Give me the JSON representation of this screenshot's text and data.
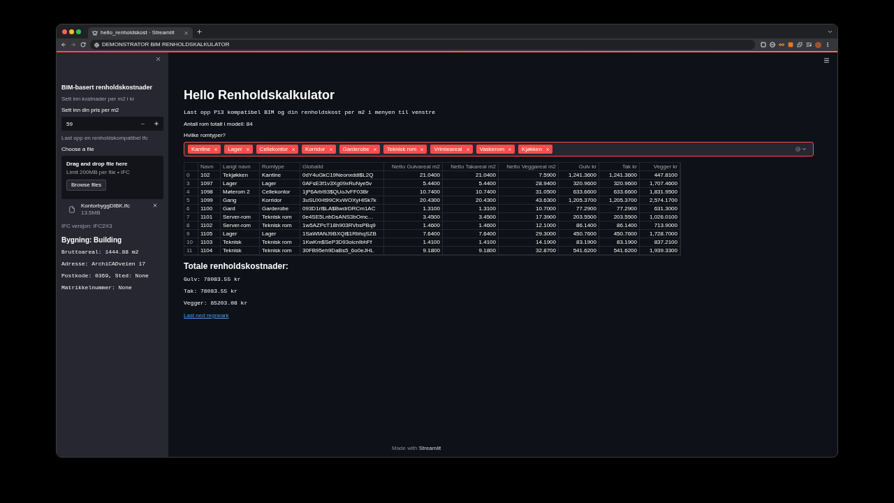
{
  "browser": {
    "tab_title": "hello_renholdskost · Streamlit",
    "address": "DEMONSTRATOR BIM RENHOLDSKALKULATOR"
  },
  "sidebar": {
    "title": "BIM-basert renholdskostnader",
    "caption": "Sett inn kostnader per m2 i kr",
    "price_input": {
      "label": "Sett inn din pris per m2",
      "value": "59"
    },
    "upload_caption": "Last opp en renholdskompatibel ifc",
    "uploader": {
      "label": "Choose a file",
      "dropzone_title": "Drag and drop file here",
      "dropzone_hint": "Limit 200MB per file • IFC",
      "browse_button": "Browse files",
      "files": [
        {
          "name": "KontorbyggDIBK.ifc",
          "size": "13.5MB"
        }
      ]
    },
    "ifc_version": "IFC versjon: IFC2X3",
    "building_heading": "Bygning: Building",
    "building_details": [
      "Bruttoareal: 1444.88 m2",
      "Adresse: ArchiCADveien 17",
      "Postkode: 0369, Sted: None",
      "Matrikkelnummer: None"
    ]
  },
  "main": {
    "title": "Hello Renholdskalkulator",
    "intro": "Last opp P13 kompatibel BIM og din renholdskost per m2 i menyen til venstre",
    "room_count": "Antall rom totalt i modell: 84",
    "multiselect": {
      "label": "Hvilke romtyper?",
      "options": [
        {
          "label": "Kantine"
        },
        {
          "label": "Lager"
        },
        {
          "label": "Cellekontor"
        },
        {
          "label": "Korridor"
        },
        {
          "label": "Garderobe"
        },
        {
          "label": "Teknisk rom"
        },
        {
          "label": "Vrimleareal"
        },
        {
          "label": "Vaskerom"
        },
        {
          "label": "Kjøkken"
        }
      ]
    },
    "table": {
      "columns": [
        {
          "label": "Navn",
          "kind": "text"
        },
        {
          "label": "Langt navn",
          "kind": "text"
        },
        {
          "label": "Romtype",
          "kind": "text"
        },
        {
          "label": "GlobalId",
          "kind": "text"
        },
        {
          "label": "Netto Gulvareal m2",
          "kind": "number"
        },
        {
          "label": "Netto Takareal m2",
          "kind": "number"
        },
        {
          "label": "Netto Veggareal m2",
          "kind": "number"
        },
        {
          "label": "Gulv kr",
          "kind": "number"
        },
        {
          "label": "Tak kr",
          "kind": "number"
        },
        {
          "label": "Vegger kr",
          "kind": "number"
        }
      ],
      "rows": [
        {
          "index": "0",
          "cells": [
            "102",
            "Tekjøkken",
            "Kantine",
            "0dY4uGkC19Neonxddi$L2Q",
            "21.0400",
            "21.0400",
            "7.5900",
            "1,241.3600",
            "1,241.3600",
            "447.8100"
          ]
        },
        {
          "index": "3",
          "cells": [
            "1097",
            "Lager",
            "Lager",
            "0AFsE3f1v3Xg09xRuNye5v",
            "5.4400",
            "5.4400",
            "28.9400",
            "320.9600",
            "320.9600",
            "1,707.4600"
          ]
        },
        {
          "index": "4",
          "cells": [
            "1098",
            "Møterom 2",
            "Cellekontor",
            "1jP6Arbl93$QUoJvFF03Br",
            "10.7400",
            "10.7400",
            "31.0500",
            "633.6600",
            "633.6600",
            "1,831.9500"
          ]
        },
        {
          "index": "5",
          "cells": [
            "1099",
            "Gang",
            "Korridor",
            "3uSUXHt99CKvWOXyHlSk7k",
            "20.4300",
            "20.4300",
            "43.6300",
            "1,205.3700",
            "1,205.3700",
            "2,574.1700"
          ]
        },
        {
          "index": "6",
          "cells": [
            "1100",
            "Gard",
            "Garderobe",
            "093D1ri$LA$BwdrDRCm1AC",
            "1.3100",
            "1.3100",
            "10.7000",
            "77.2900",
            "77.2900",
            "631.3000"
          ]
        },
        {
          "index": "7",
          "cells": [
            "1101",
            "Server-rom",
            "Teknisk rom",
            "0e4SE5LnbDsANS3bOmc…",
            "3.4500",
            "3.4500",
            "17.3900",
            "203.5500",
            "203.5500",
            "1,026.0100"
          ]
        },
        {
          "index": "8",
          "cells": [
            "1102",
            "Server-rom",
            "Teknisk rom",
            "1w5AZPcT18h903RVbsPBq9",
            "1.4600",
            "1.4600",
            "12.1000",
            "86.1400",
            "86.1400",
            "713.9000"
          ]
        },
        {
          "index": "9",
          "cells": [
            "1105",
            "Lager",
            "Lager",
            "1SaWfANJ9BXQi$1RbhqSZB",
            "7.6400",
            "7.6400",
            "29.3000",
            "450.7600",
            "450.7600",
            "1,728.7000"
          ]
        },
        {
          "index": "10",
          "cells": [
            "1103",
            "Teknisk",
            "Teknisk rom",
            "1KwKm$SeP3D93oicnIbhFf",
            "1.4100",
            "1.4100",
            "14.1900",
            "83.1900",
            "83.1900",
            "837.2100"
          ]
        },
        {
          "index": "11",
          "cells": [
            "1104",
            "Teknisk",
            "Teknisk rom",
            "30FB95eh9DaBs5_6o0eJHL",
            "9.1800",
            "9.1800",
            "32.8700",
            "541.6200",
            "541.6200",
            "1,939.3300"
          ]
        }
      ]
    },
    "totals_heading": "Totale renholdskostnader:",
    "totals": [
      "Gulv: 78083.55 kr",
      "Tak: 78083.55 kr",
      "Vegger: 85203.08 kr"
    ],
    "download_link": "Last ned regneark"
  },
  "footer": {
    "text": "Made with **Streamlit**"
  }
}
